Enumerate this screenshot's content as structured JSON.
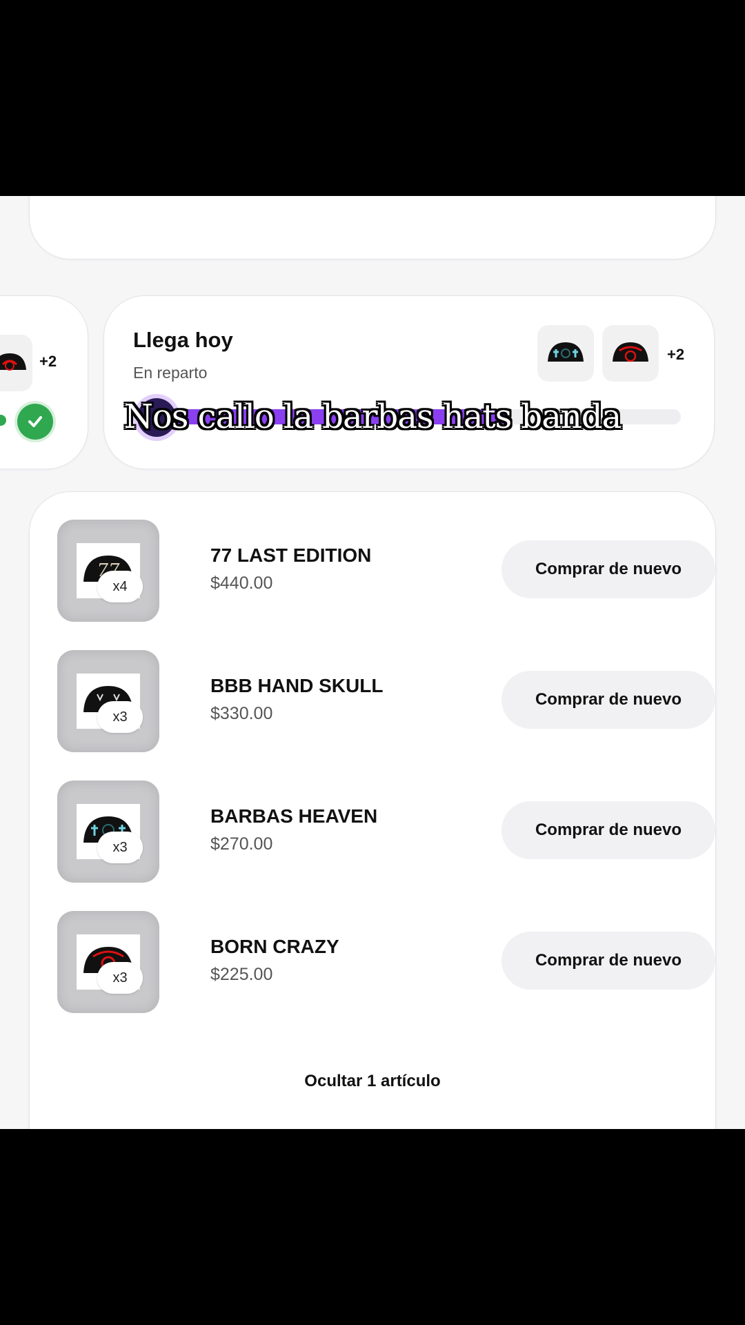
{
  "colors": {
    "accent": "#8a3ff0",
    "success": "#2fa84f",
    "background": "#f6f6f7"
  },
  "left_card": {
    "count": "+2"
  },
  "delivery": {
    "title": "Llega hoy",
    "status": "En reparto",
    "extra_count": "+2",
    "progress": 0.68
  },
  "caption": "Nos callo la barbas hats banda",
  "items": [
    {
      "name": "77 LAST EDITION",
      "price": "$440.00",
      "qty": "x4",
      "button": "Comprar de nuevo",
      "icon": "cap-77"
    },
    {
      "name": "BBB HAND SKULL",
      "price": "$330.00",
      "qty": "x3",
      "button": "Comprar de nuevo",
      "icon": "cap-hand-skull"
    },
    {
      "name": "BARBAS HEAVEN",
      "price": "$270.00",
      "qty": "x3",
      "button": "Comprar de nuevo",
      "icon": "cap-heaven"
    },
    {
      "name": "BORN CRAZY",
      "price": "$225.00",
      "qty": "x3",
      "button": "Comprar de nuevo",
      "icon": "cap-born-crazy"
    }
  ],
  "hide_link": "Ocultar 1 artículo"
}
